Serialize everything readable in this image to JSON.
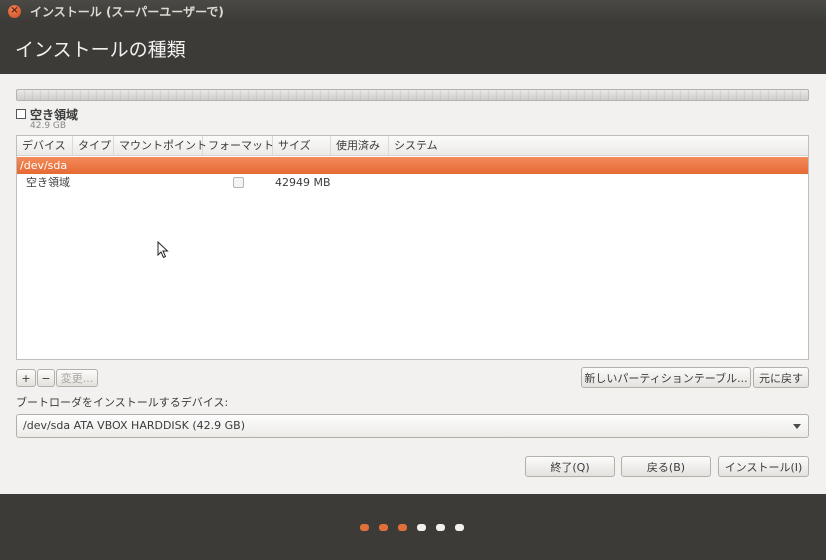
{
  "window": {
    "title": "インストール (スーパーユーザーで)",
    "close_symbol": "×"
  },
  "page": {
    "title": "インストールの種類"
  },
  "legend": {
    "label": "空き領域",
    "size": "42.9 GB"
  },
  "table": {
    "columns": [
      "デバイス",
      "タイプ",
      "マウントポイント",
      "フォーマット",
      "サイズ",
      "使用済み",
      "システム"
    ],
    "selected_row": "/dev/sda",
    "rows": [
      {
        "device": "空き領域",
        "type": "",
        "mount": "",
        "format": false,
        "size": "42949 MB",
        "used": "",
        "system": ""
      }
    ]
  },
  "buttons": {
    "add": "+",
    "remove": "−",
    "change": "変更...",
    "new_table": "新しいパーティションテーブル...",
    "revert": "元に戻す",
    "quit": "終了(Q)",
    "back": "戻る(B)",
    "install": "インストール(I)"
  },
  "bootloader": {
    "label": "ブートローダをインストールするデバイス:",
    "selected": "/dev/sda ATA VBOX HARDDISK (42.9 GB)"
  },
  "progress": {
    "total_steps": 6,
    "completed_steps": 3,
    "colors": {
      "done": "#e0703a",
      "todo": "#f2f1f0"
    }
  }
}
